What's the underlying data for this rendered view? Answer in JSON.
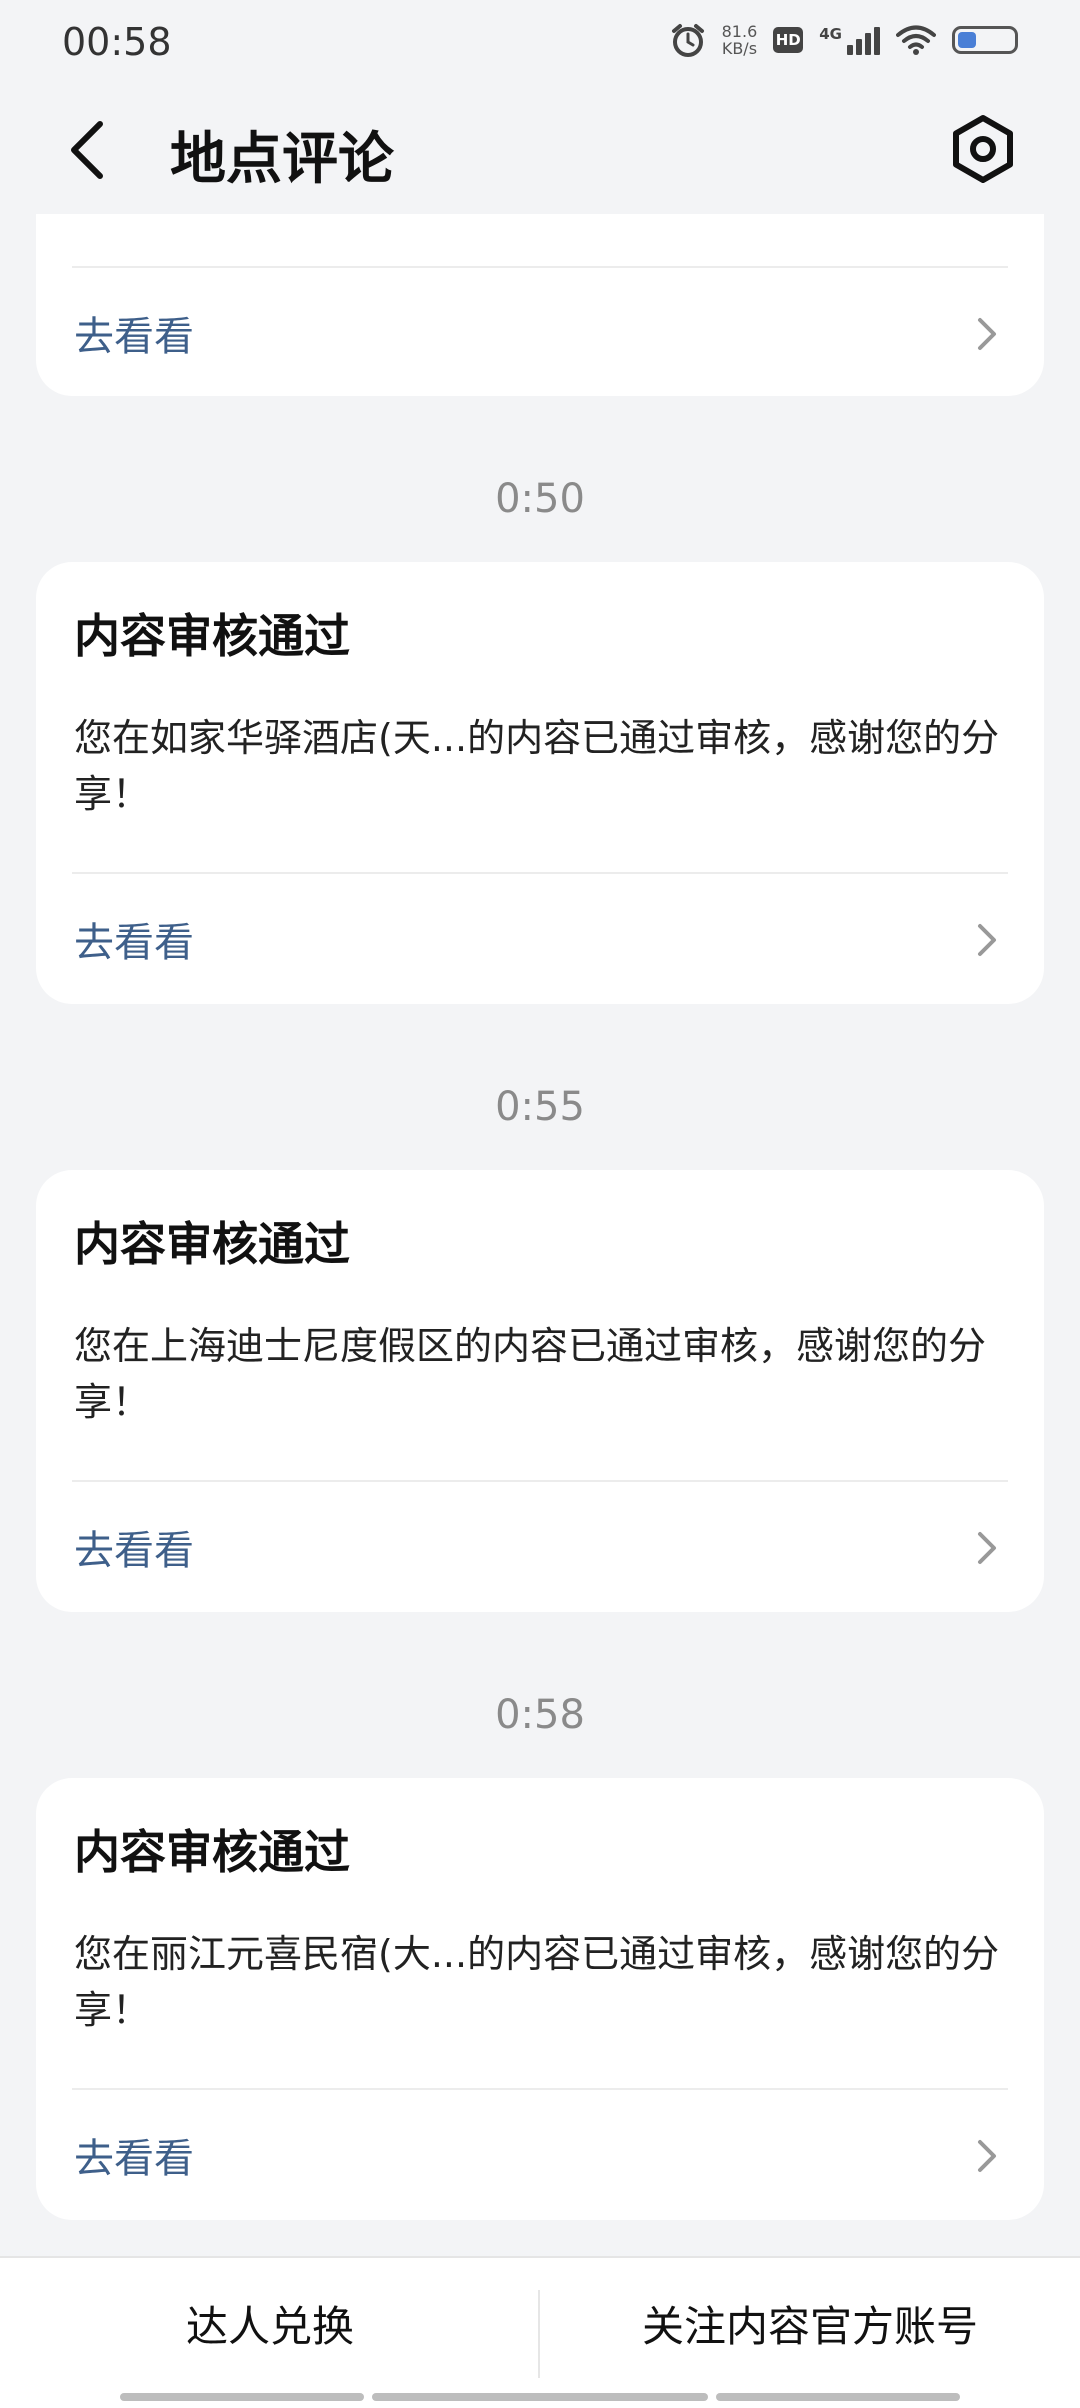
{
  "status_bar": {
    "time": "00:58",
    "net_speed_value": "81.6",
    "net_speed_unit": "KB/s",
    "hd_badge": "HD",
    "network_type": "4G",
    "icons": [
      "alarm-icon",
      "hd-icon",
      "signal-icon",
      "wifi-icon",
      "battery-icon"
    ]
  },
  "header": {
    "title": "地点评论",
    "back_icon": "back-arrow-icon",
    "settings_icon": "settings-hexagon-icon"
  },
  "messages": [
    {
      "time": "",
      "title": "",
      "body": "",
      "link": "去看看"
    },
    {
      "time": "0:50",
      "title": "内容审核通过",
      "body": "您在如家华驿酒店(天...的内容已通过审核，感谢您的分享！",
      "link": "去看看"
    },
    {
      "time": "0:55",
      "title": "内容审核通过",
      "body": "您在上海迪士尼度假区的内容已通过审核，感谢您的分享！",
      "link": "去看看"
    },
    {
      "time": "0:58",
      "title": "内容审核通过",
      "body": "您在丽江元喜民宿(大...的内容已通过审核，感谢您的分享！",
      "link": "去看看"
    }
  ],
  "bottom_bar": {
    "left_button": "达人兑换",
    "right_button": "关注内容官方账号"
  },
  "colors": {
    "background": "#f3f4f6",
    "card": "#ffffff",
    "link": "#3e5f8a",
    "timestamp": "#8a8a8a"
  }
}
